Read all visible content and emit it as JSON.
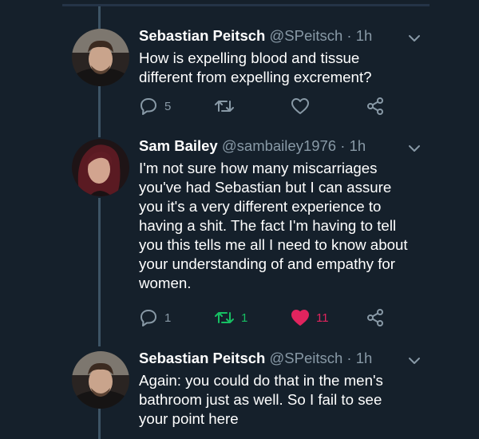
{
  "tweets": [
    {
      "name": "Sebastian Peitsch",
      "handle": "@SPeitsch",
      "dot": "·",
      "time": "1h",
      "lines": [
        "How is expelling blood and tissue",
        "different from expelling excrement?"
      ],
      "replies": "5",
      "retweets": "",
      "likes": ""
    },
    {
      "name": "Sam Bailey",
      "handle": "@sambailey1976",
      "dot": "·",
      "time": "1h",
      "lines": [
        "I'm not sure how many miscarriages",
        "you've had Sebastian but I can assure",
        "you it's a very different experience to",
        "having a shit.  The fact I'm having to tell",
        "you this tells me all I need to know about",
        "your understanding of and empathy for",
        "women."
      ],
      "replies": "1",
      "retweets": "1",
      "likes": "11"
    },
    {
      "name": "Sebastian Peitsch",
      "handle": "@SPeitsch",
      "dot": "·",
      "time": "1h",
      "lines": [
        "Again: you could do that in the men's",
        "bathroom just as well. So I fail to see",
        "your point here"
      ]
    }
  ],
  "icons": {
    "reply": "reply-icon",
    "retweet": "retweet-icon",
    "like": "heart-icon",
    "share": "share-icon",
    "menu": "chevron-down-icon"
  },
  "colors": {
    "background": "#15202b",
    "secondary_text": "#8899a6",
    "retweet_active": "#17bf63",
    "like_active": "#e0245e"
  }
}
